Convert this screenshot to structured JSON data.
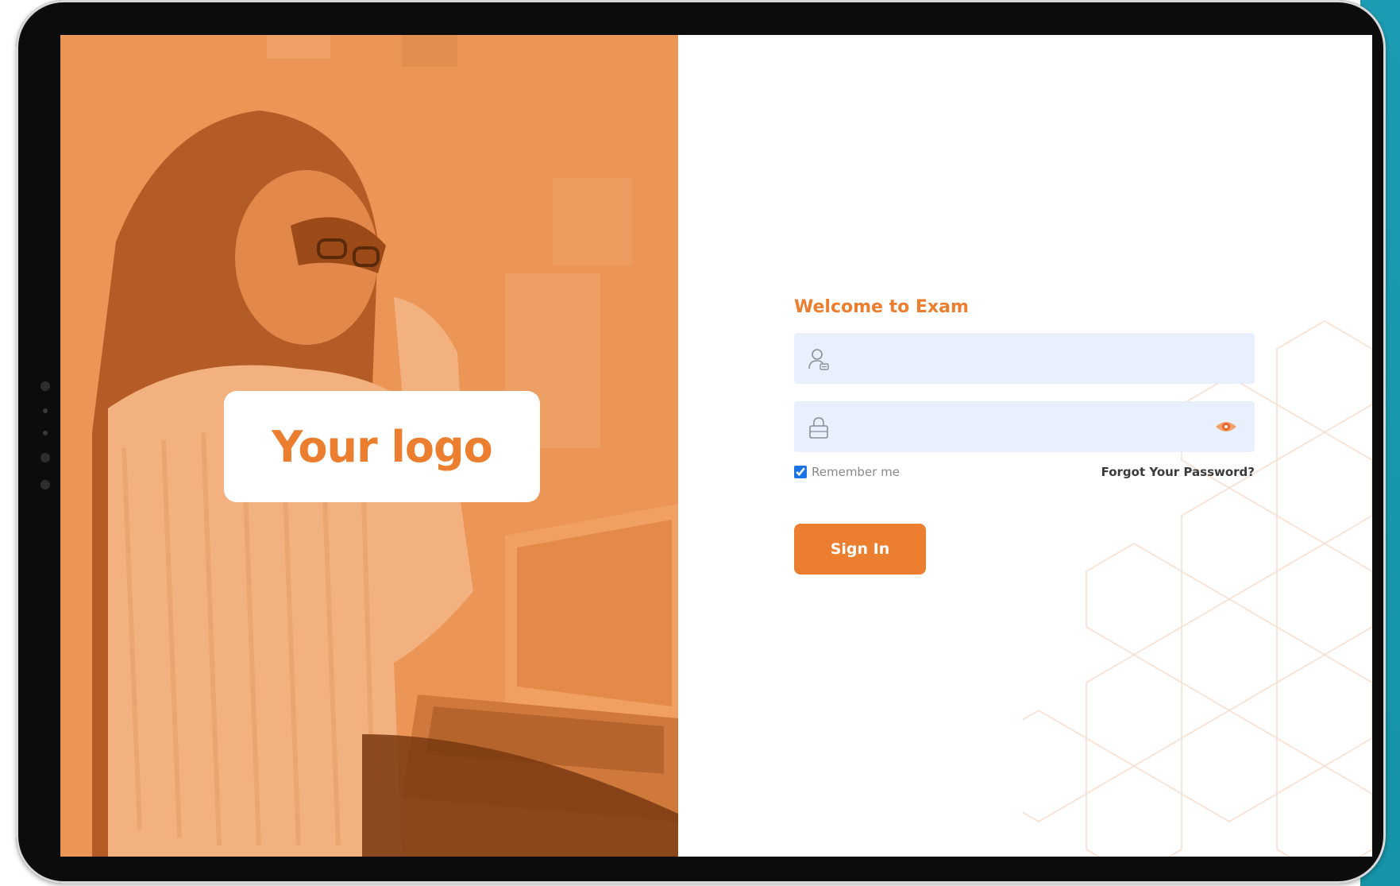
{
  "brand": {
    "logo_text": "Your logo"
  },
  "login": {
    "title": "Welcome to Exam",
    "username": {
      "placeholder": "",
      "value": ""
    },
    "password": {
      "placeholder": "",
      "value": ""
    },
    "remember_label": "Remember me",
    "remember_checked": true,
    "forgot_label": "Forgot Your Password?",
    "signin_label": "Sign In"
  },
  "colors": {
    "accent": "#ec7e2f",
    "input_bg": "#e8f0fe",
    "device_frame": "#0c0c0c",
    "teal_bg": "#1693a7"
  },
  "icons": {
    "username": "user-icon",
    "password": "lock-icon",
    "toggle": "eye-icon"
  }
}
